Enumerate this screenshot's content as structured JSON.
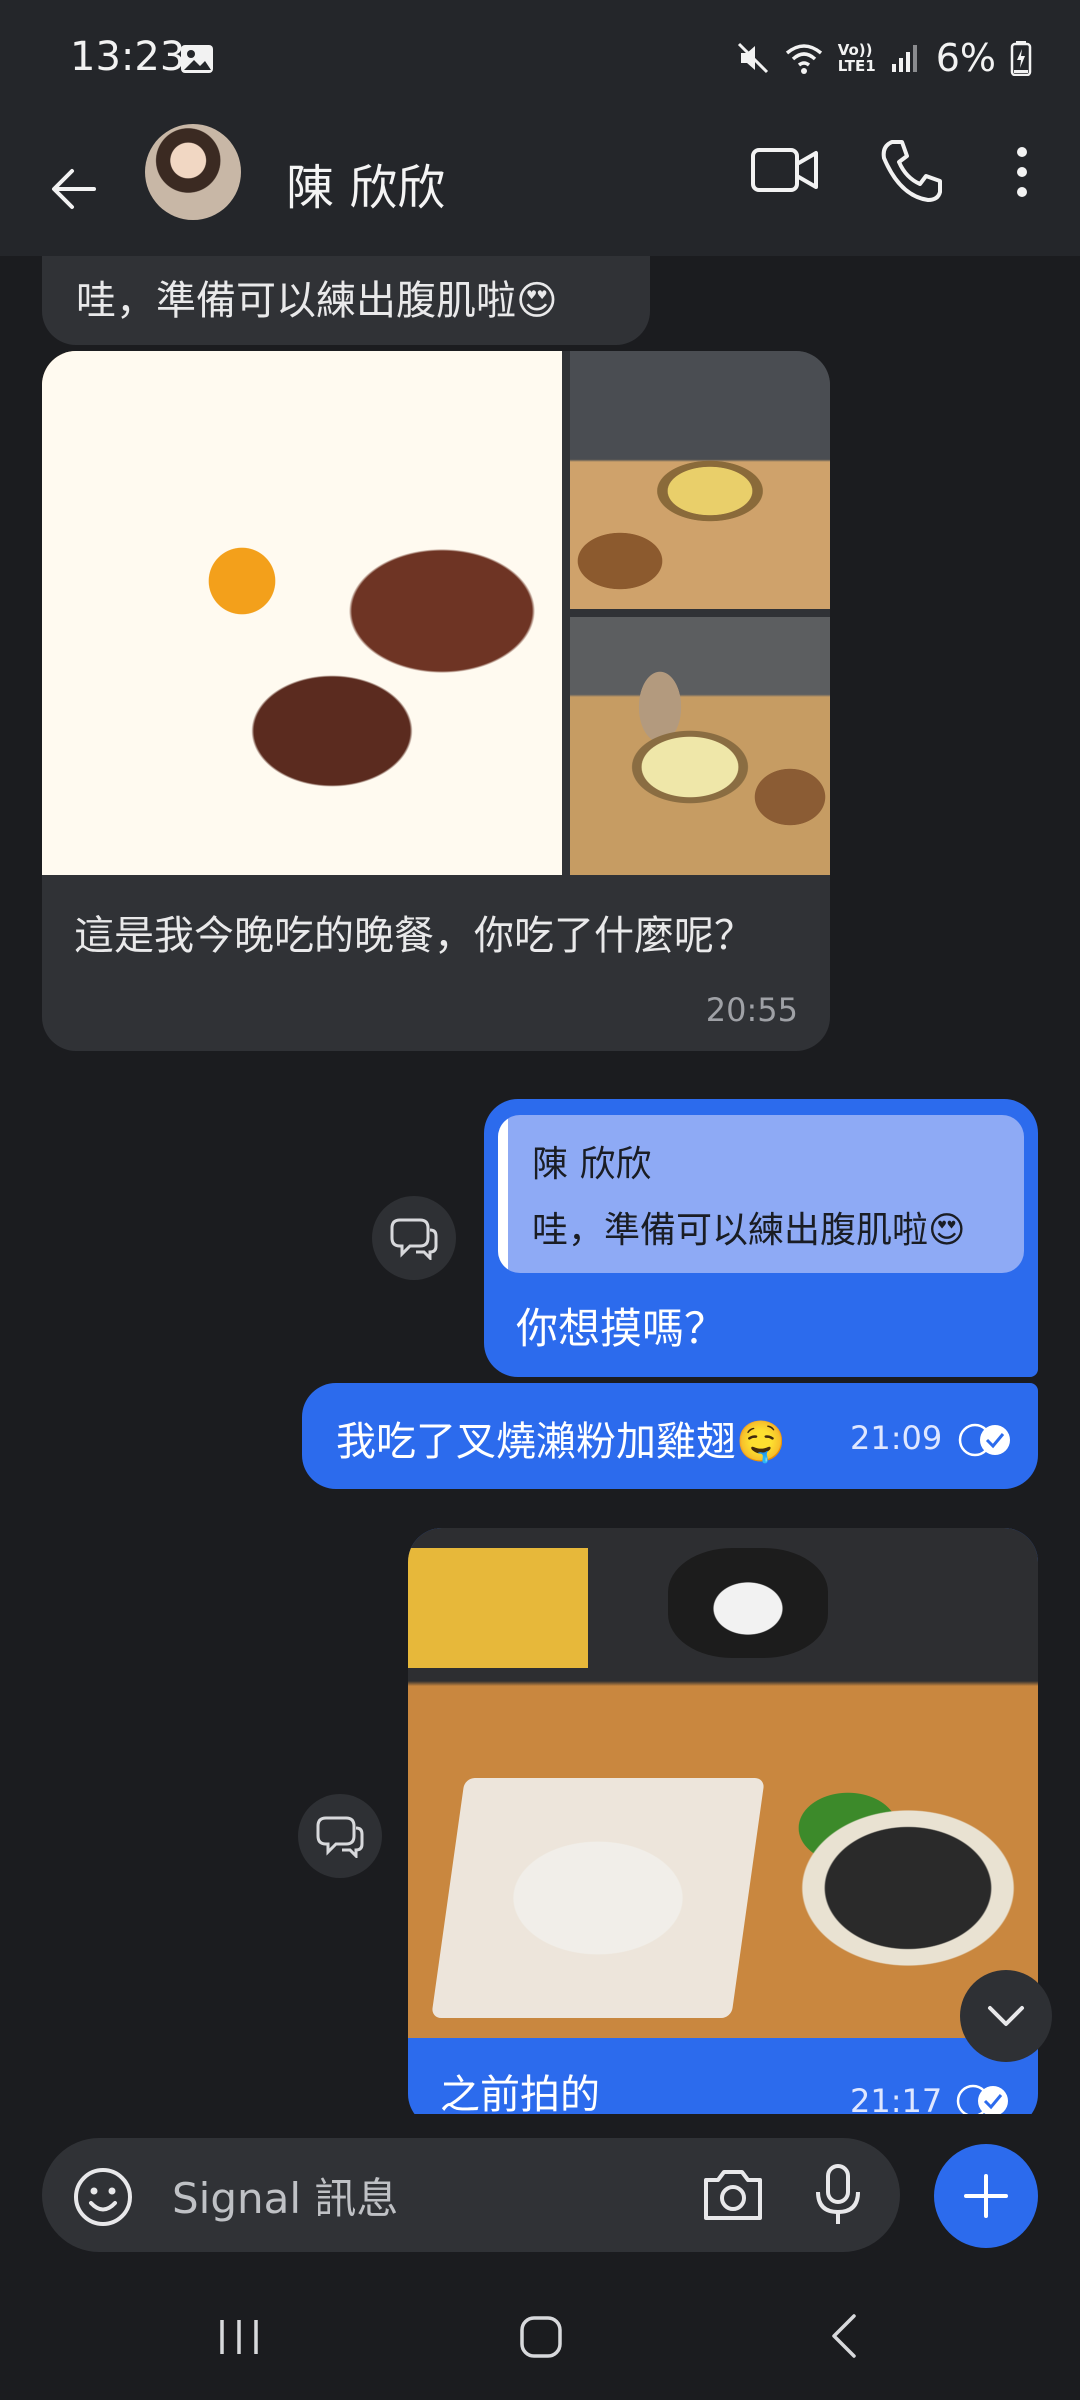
{
  "status_bar": {
    "time": "13:23",
    "battery": "6%",
    "icons": [
      "image-icon",
      "mute-icon",
      "wifi-icon",
      "volte-icon",
      "signal-icon",
      "battery-charging-icon"
    ],
    "network_label_top": "Vo))",
    "network_label_bottom": "LTE1"
  },
  "header": {
    "contact_name": "陳 欣欣",
    "icons": [
      "back-arrow-icon",
      "video-call-icon",
      "phone-icon",
      "more-vert-icon"
    ]
  },
  "messages": [
    {
      "direction": "incoming",
      "text": "哇，準備可以練出腹肌啦😍"
    },
    {
      "direction": "incoming",
      "photos": 3,
      "caption": "這是我今晚吃的晚餐，你吃了什麼呢？",
      "time": "20:55"
    },
    {
      "direction": "outgoing",
      "quote_author": "陳 欣欣",
      "quote_text": "哇，準備可以練出腹肌啦😍",
      "text": "你想摸嗎？"
    },
    {
      "direction": "outgoing",
      "text": "我吃了叉燒瀨粉加雞翅🤤",
      "time": "21:09"
    },
    {
      "direction": "outgoing",
      "photos": 1,
      "caption": "之前拍的",
      "time": "21:17"
    }
  ],
  "composer": {
    "placeholder": "Signal 訊息"
  },
  "colors": {
    "background": "#1b1c1f",
    "incoming_bubble": "#303236",
    "outgoing_bubble": "#2c6bed",
    "quote_bg": "#8eaaf5"
  }
}
